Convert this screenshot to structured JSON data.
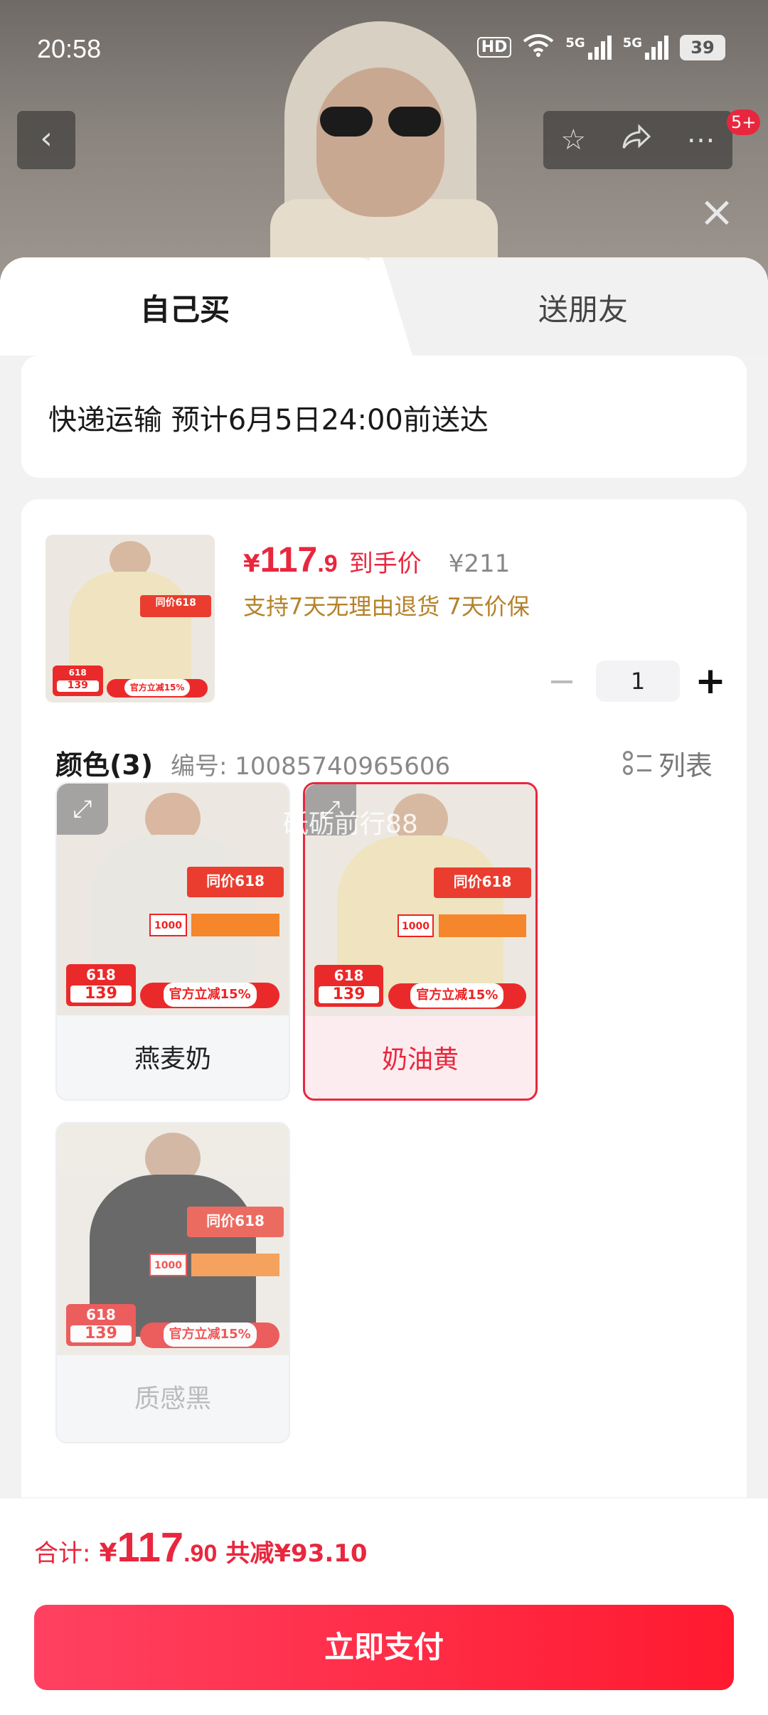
{
  "status_bar": {
    "time": "20:58",
    "hd": "HD",
    "net1": "5G",
    "net2": "5G",
    "battery": "39"
  },
  "nav": {
    "back_icon": "chevron-left",
    "actions": [
      "star-icon",
      "share-icon",
      "more-icon"
    ],
    "badge": "5+"
  },
  "tabs": [
    {
      "label": "自己买"
    },
    {
      "label": "送朋友"
    }
  ],
  "delivery": {
    "text": "快递运输 预计6月5日24:00前送达"
  },
  "product": {
    "price_currency": "¥",
    "price_int": "117",
    "price_dec": ".9",
    "price_label": "到手价",
    "original_price": "¥211",
    "guarantee": "支持7天无理由退货 7天价保",
    "quantity": "1",
    "minus": "−",
    "plus": "+"
  },
  "colors": {
    "title": "颜色(3)",
    "code": "编号: 10085740965606",
    "view_toggle": "列表",
    "options": [
      {
        "name": "燕麦奶",
        "state": "normal",
        "coat_color": "#e9e7e2"
      },
      {
        "name": "奶油黄",
        "state": "selected",
        "coat_color": "#efe4bf"
      },
      {
        "name": "质感黑",
        "state": "disabled",
        "coat_color": "#3c3b3b"
      }
    ]
  },
  "promo_image": {
    "tag_618": "618",
    "tag_price": "139",
    "promo_text": "官方立减15%",
    "same_price": "同价618",
    "coupon": "1000"
  },
  "watermark": "砥砺前行88",
  "footer": {
    "total_label": "合计:",
    "total_currency": "¥",
    "total_int": "117",
    "total_dec": ".90",
    "saved": "共减¥93.10",
    "pay_button": "立即支付"
  },
  "colors_theme": {
    "accent": "#e8273e",
    "guarantee": "#b58229"
  }
}
